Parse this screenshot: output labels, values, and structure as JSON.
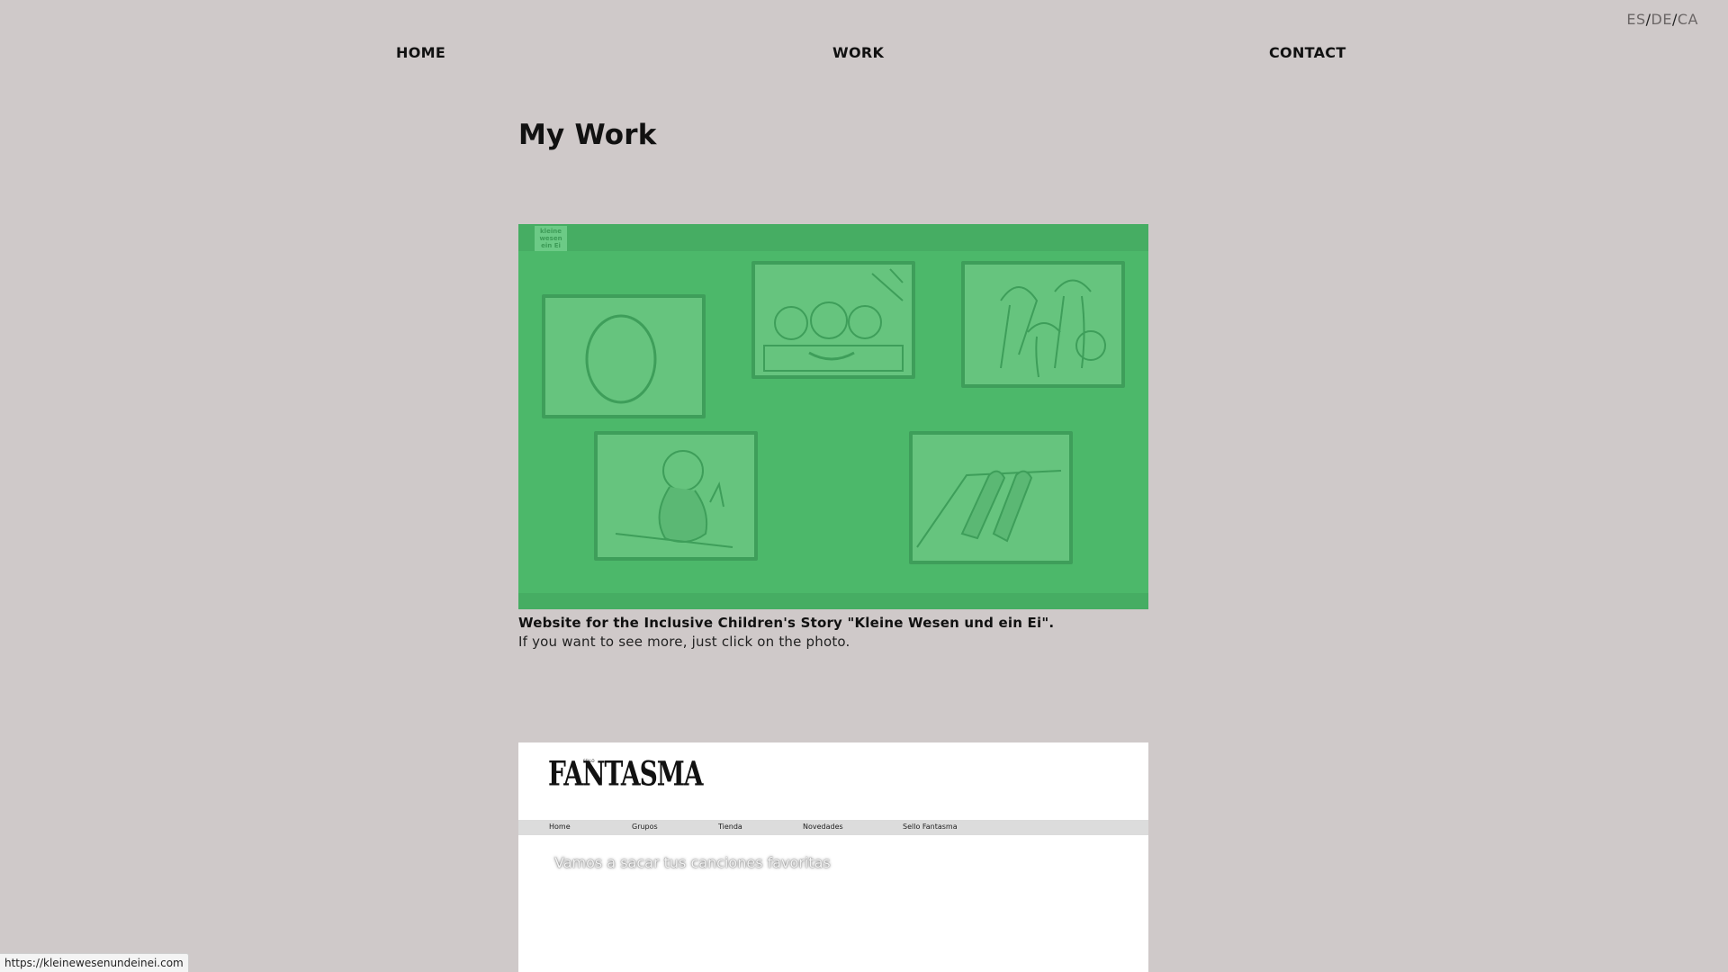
{
  "language_switcher": {
    "es": "ES",
    "separator": "/",
    "de": "DE",
    "ca": "CA"
  },
  "nav": {
    "home": "HOME",
    "work": "WORK",
    "contact": "CONTACT"
  },
  "page": {
    "title": "My Work"
  },
  "projects": [
    {
      "screenshot": {
        "logo_text": "kleine wesen ein Ei",
        "accent_color": "#4cb86a"
      },
      "caption_title": "Website for the Inclusive Children's Story \"Kleine Wesen und ein Ei\".",
      "caption_sub": "If you want to see more, just click on the photo."
    },
    {
      "screenshot": {
        "logo_small": "SELLO",
        "logo_text": "FANTASMA",
        "nav": [
          "Home",
          "Grupos",
          "Tienda",
          "Novedades",
          "Sello Fantasma"
        ],
        "hero_text": "Vamos a sacar tus canciones favoritas"
      }
    }
  ],
  "status_bar": {
    "url": "https://kleinewesenundeinei.com"
  },
  "colors": {
    "background": "#cfc9c9",
    "card_green": "#4cb86a",
    "frame_border": "#3e9e5a"
  }
}
